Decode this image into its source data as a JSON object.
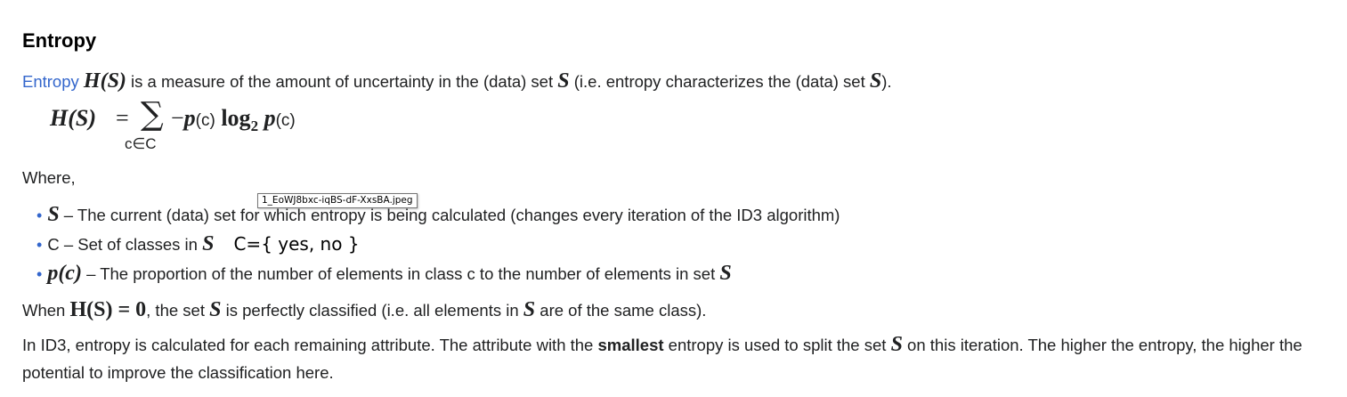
{
  "heading": "Entropy",
  "intro": {
    "link_text": "Entropy",
    "math_H": "H(S)",
    "text1": " is a measure of the amount of uncertainty in the (data) set ",
    "math_S1": "S",
    "text2": " (i.e. entropy characterizes the (data) set ",
    "math_S2": "S",
    "text3": ")."
  },
  "formula": {
    "lhs": "H(S)",
    "eq": "=",
    "sum": "∑",
    "sub": "c∈C",
    "body_minus": "−",
    "p1": "p",
    "c1": "(c)",
    "log": " log",
    "log_sub": "2",
    "p2": " p",
    "c2": "(c)"
  },
  "where_label": "Where,",
  "bullets": [
    {
      "math": "S",
      "text": " – The current (data) set for which entropy is being calculated (changes every iteration of the ID3 algorithm)"
    },
    {
      "sym": "C",
      "text": "  – Set of classes in ",
      "math": "S",
      "annotation": "C={ yes, no }"
    },
    {
      "math": "p(c)",
      "text1": " – The proportion of the number of elements in class ",
      "sym": "c",
      "text2": " to the number of elements in set ",
      "math2": "S"
    }
  ],
  "when": {
    "text1": "When ",
    "math1": "H(S) = 0",
    "text2": ", the set ",
    "math2": "S",
    "text3": " is perfectly classified (i.e. all elements in ",
    "math3": "S",
    "text4": " are of the same class)."
  },
  "paragraph": {
    "text1": "In ID3, entropy is calculated for each remaining attribute. The attribute with the ",
    "bold": "smallest",
    "text2": " entropy is used to split the set ",
    "math": "S",
    "text3": " on this iteration. The higher the entropy, the higher the potential to improve the classification here."
  },
  "tooltip": "1_EoWJ8bxc-iqBS-dF-XxsBA.jpeg"
}
